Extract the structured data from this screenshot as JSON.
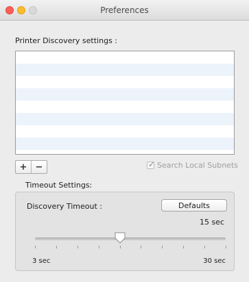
{
  "window": {
    "title": "Preferences"
  },
  "printer_discovery": {
    "section_label": "Printer Discovery settings :",
    "list_rows": 8,
    "add_button": "+",
    "remove_button": "−",
    "search_local_subnets": {
      "label": "Search Local Subnets",
      "checked": true,
      "enabled": false
    }
  },
  "timeout": {
    "section_label": "Timeout Settings:",
    "discovery_label": "Discovery Timeout :",
    "defaults_button": "Defaults",
    "value_text": "15 sec",
    "slider": {
      "min": 3,
      "max": 30,
      "value": 15,
      "ticks": 10,
      "min_label": "3 sec",
      "max_label": "30 sec"
    }
  },
  "colors": {
    "list_alt_row": "#edf3fb",
    "close": "#fc5f57",
    "minimize": "#fdbc2e"
  }
}
